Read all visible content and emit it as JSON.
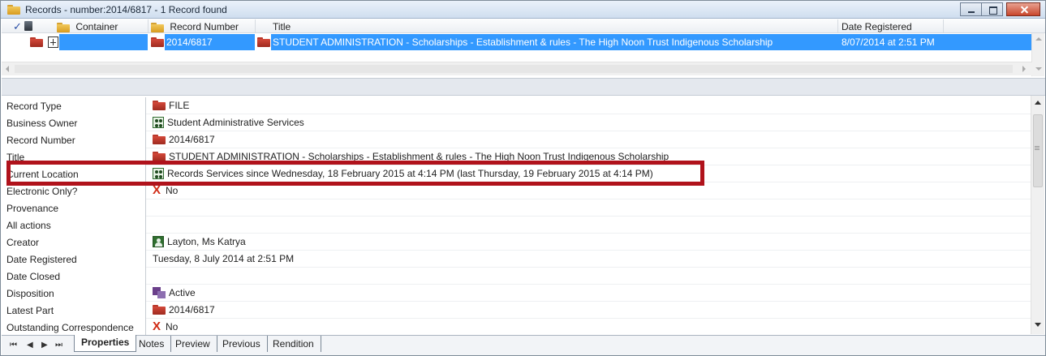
{
  "window": {
    "title": "Records - number:2014/6817 - 1 Record found",
    "buttons": [
      "minimize-icon",
      "maximize-icon",
      "close-icon"
    ]
  },
  "grid": {
    "columns": [
      "Container",
      "Record Number",
      "Title",
      "Date Registered"
    ],
    "row": {
      "record_number": "2014/6817",
      "title": "STUDENT ADMINISTRATION - Scholarships - Establishment & rules - The High Noon Trust Indigenous Scholarship",
      "date_registered": "8/07/2014 at 2:51 PM"
    },
    "selection_color": "#3399ff"
  },
  "properties": [
    {
      "label": "Record Type",
      "value": "FILE",
      "icon": "folder-icon"
    },
    {
      "label": "Business Owner",
      "value": "Student Administrative Services",
      "icon": "group-icon"
    },
    {
      "label": "Record Number",
      "value": "2014/6817",
      "icon": "folder-icon"
    },
    {
      "label": "Title",
      "value": "STUDENT ADMINISTRATION - Scholarships - Establishment & rules - The High Noon Trust Indigenous Scholarship",
      "icon": "folder-icon"
    },
    {
      "label": "Current Location",
      "value": "Records Services since Wednesday, 18 February 2015 at 4:14 PM (last Thursday, 19 February 2015 at 4:14 PM)",
      "icon": "group-icon"
    },
    {
      "label": "Electronic Only?",
      "value": "No",
      "icon": "x-icon"
    },
    {
      "label": "Provenance",
      "value": "",
      "icon": ""
    },
    {
      "label": "All actions",
      "value": "",
      "icon": ""
    },
    {
      "label": "Creator",
      "value": "Layton, Ms Katrya",
      "icon": "person-icon"
    },
    {
      "label": "Date Registered",
      "value": "Tuesday, 8 July 2014 at 2:51 PM",
      "icon": ""
    },
    {
      "label": "Date Closed",
      "value": "",
      "icon": ""
    },
    {
      "label": "Disposition",
      "value": "Active",
      "icon": "active-icon"
    },
    {
      "label": "Latest Part",
      "value": "2014/6817",
      "icon": "folder-icon"
    },
    {
      "label": "Outstanding Correspondence",
      "value": "No",
      "icon": "x-icon"
    }
  ],
  "highlight_color": "#b0121b",
  "tabs": {
    "nav": [
      "⧏◀",
      "◀",
      "▶",
      "▶⧐"
    ],
    "items": [
      "Properties",
      "Notes",
      "Preview",
      "Previous",
      "Rendition"
    ],
    "active": "Properties"
  }
}
